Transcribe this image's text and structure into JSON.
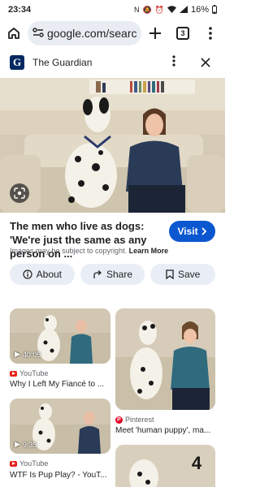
{
  "status_bar": {
    "time": "23:34",
    "battery": "16%"
  },
  "browser": {
    "url": "google.com/search?",
    "tab_count": "3"
  },
  "source": {
    "name": "The Guardian",
    "logo_letter": "G"
  },
  "result": {
    "title": "The men who live as dogs: 'We're just the same as any person on ...",
    "visit_label": "Visit",
    "copyright_text": "Images may be subject to copyright.",
    "learn_more": "Learn More"
  },
  "actions": {
    "about": "About",
    "share": "Share",
    "save": "Save"
  },
  "related": [
    {
      "duration": "40:05",
      "source": "YouTube",
      "title": "Why I Left My Fiancé to ..."
    },
    {
      "source": "Pinterest",
      "title": "Meet 'human puppy', ma..."
    },
    {
      "duration": "9:35",
      "source": "YouTube",
      "title": "WTF Is Pup Play? - YouT..."
    },
    {
      "logo": "4"
    }
  ],
  "colors": {
    "accent": "#0b57d0",
    "guardian": "#052962",
    "youtube": "#e62117",
    "pinterest": "#e60023"
  }
}
